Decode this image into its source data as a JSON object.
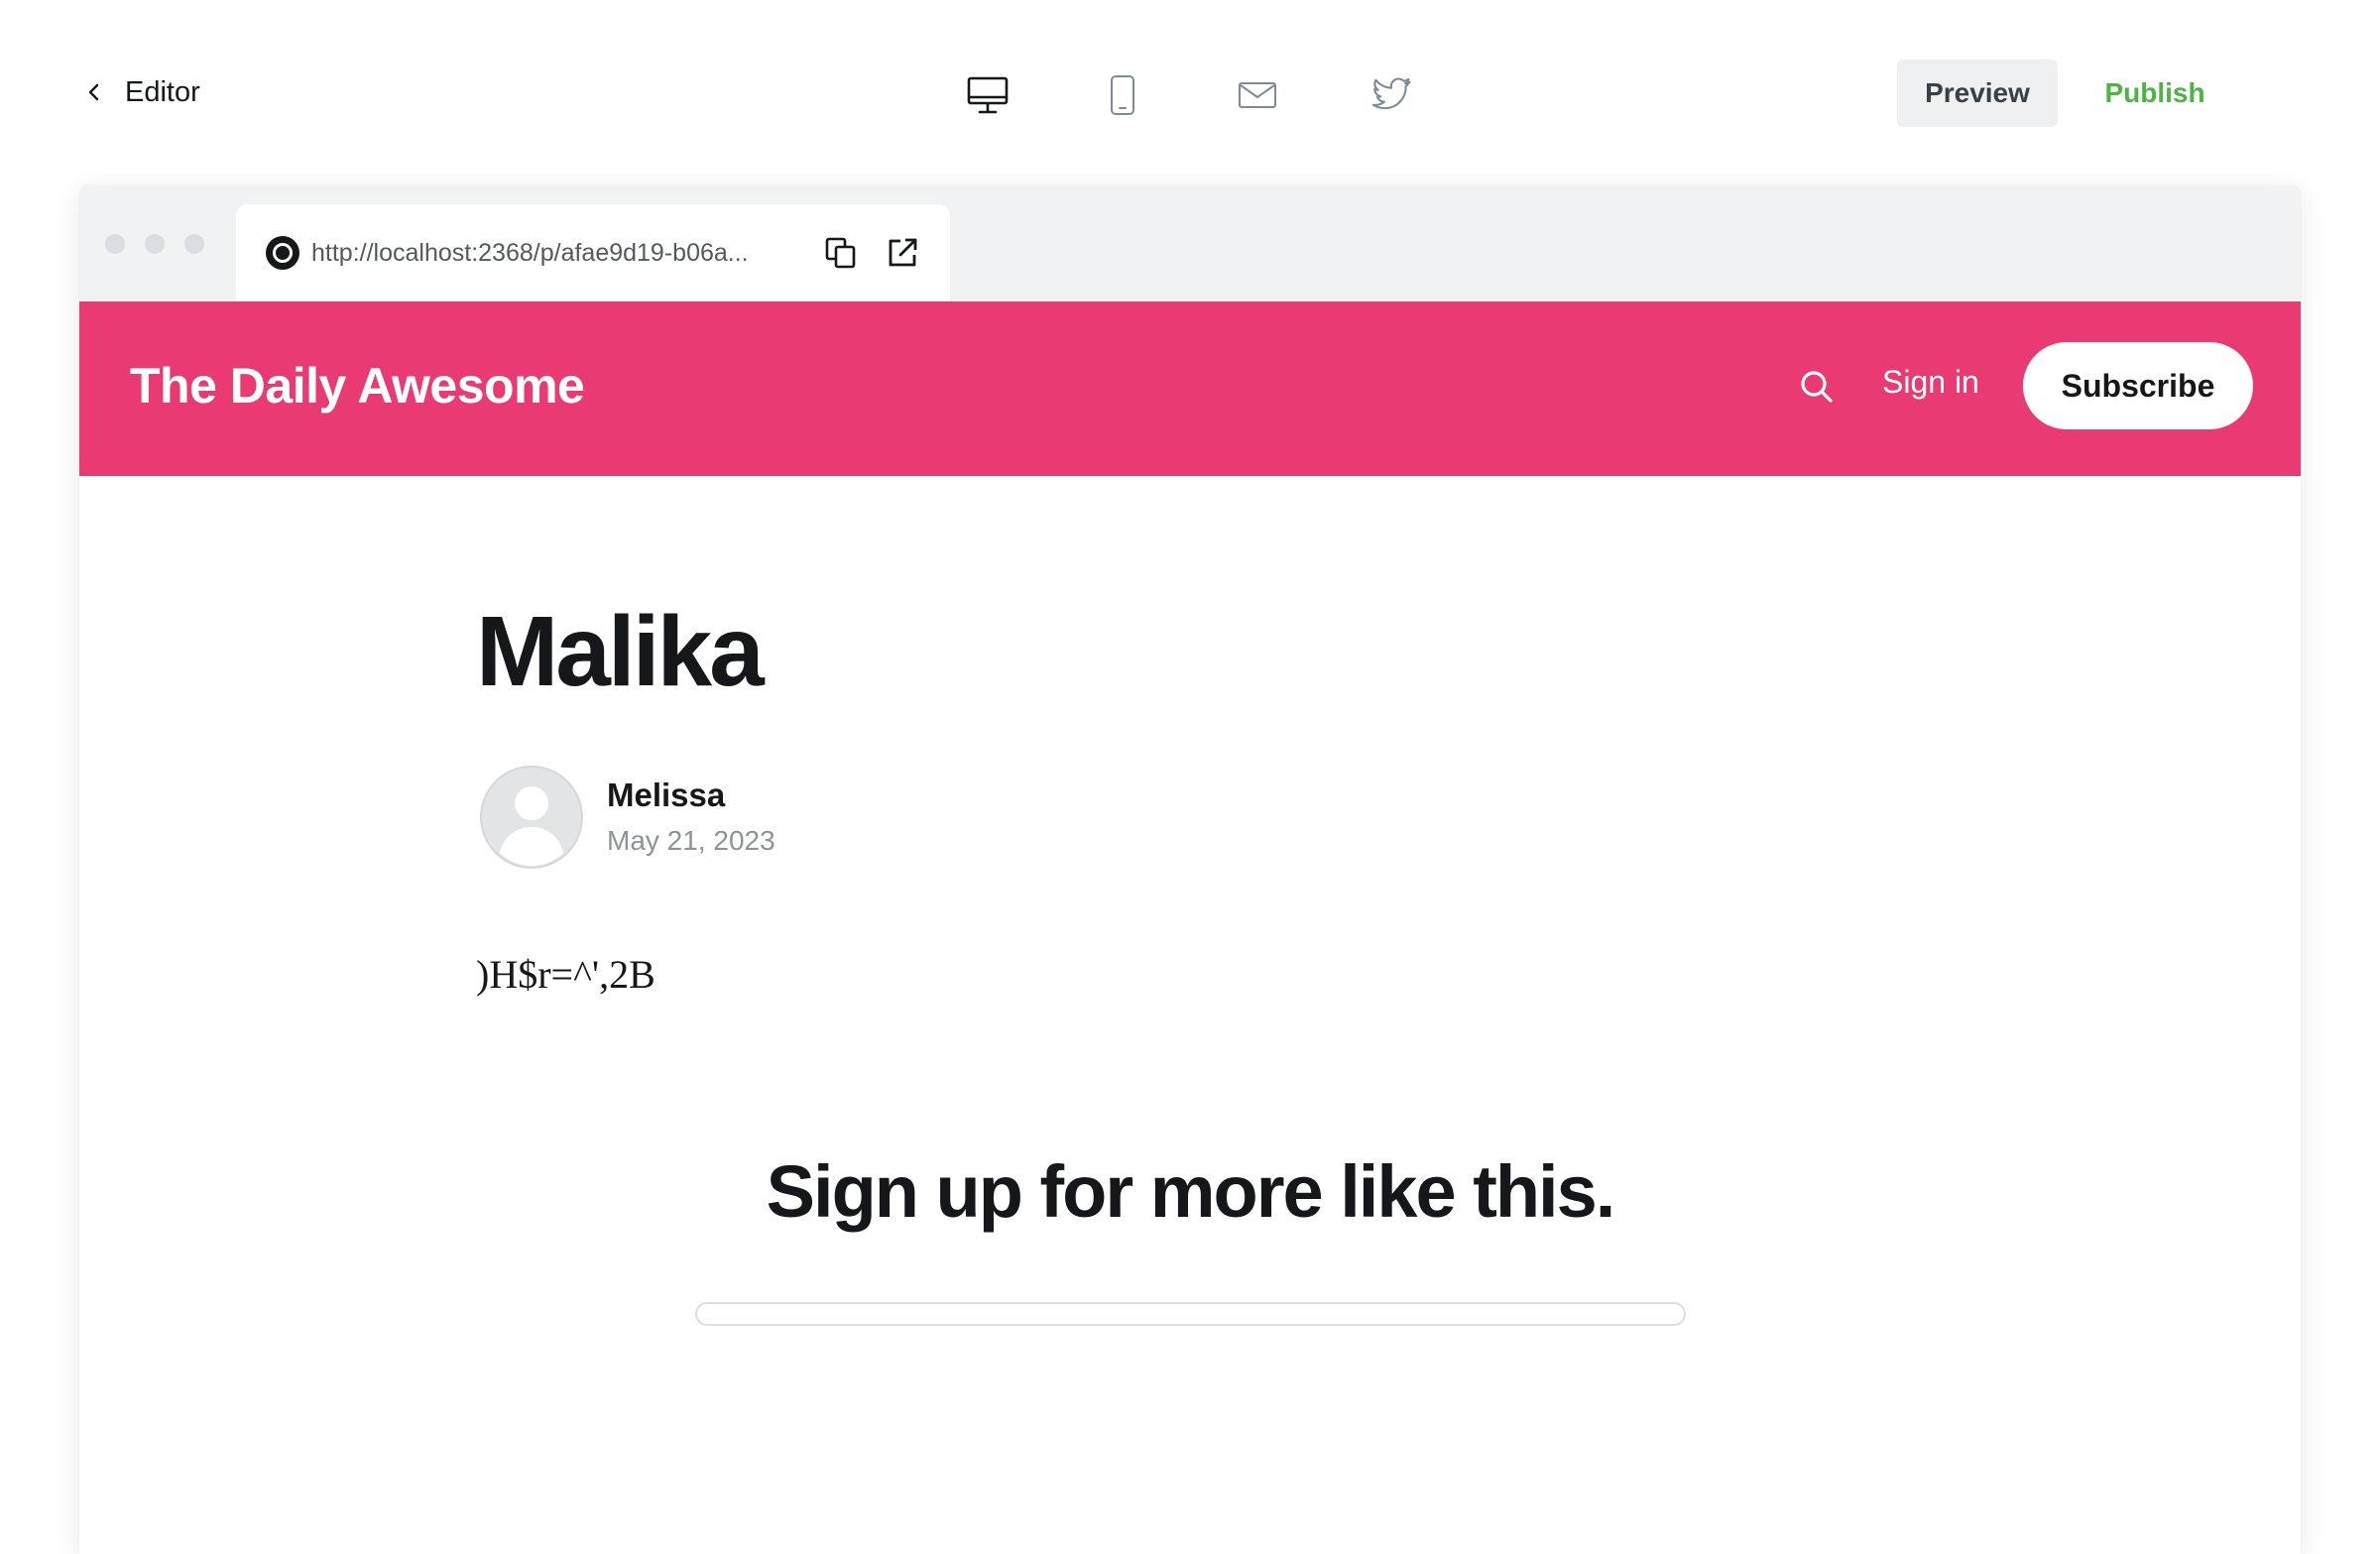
{
  "toolbar": {
    "back_label": "Editor",
    "devices": [
      {
        "name": "desktop",
        "icon": "desktop-icon",
        "active": true
      },
      {
        "name": "mobile",
        "icon": "mobile-icon",
        "active": false
      },
      {
        "name": "email",
        "icon": "envelope-icon",
        "active": false
      },
      {
        "name": "twitter",
        "icon": "twitter-icon",
        "active": false
      }
    ],
    "preview_label": "Preview",
    "publish_label": "Publish",
    "publish_color": "#4cb544"
  },
  "browser": {
    "url": "http://localhost:2368/p/afae9d19-b06a...",
    "copy_icon": "copy-icon",
    "open_icon": "external-link-icon"
  },
  "site": {
    "title": "The Daily Awesome",
    "accent_color": "#e93a74",
    "signin_label": "Sign in",
    "subscribe_label": "Subscribe",
    "search_icon": "search-icon"
  },
  "post": {
    "title": "Malika",
    "author": "Melissa",
    "date": "May 21, 2023",
    "body": ")H$r=^',2B"
  },
  "cta": {
    "title": "Sign up for more like this."
  }
}
